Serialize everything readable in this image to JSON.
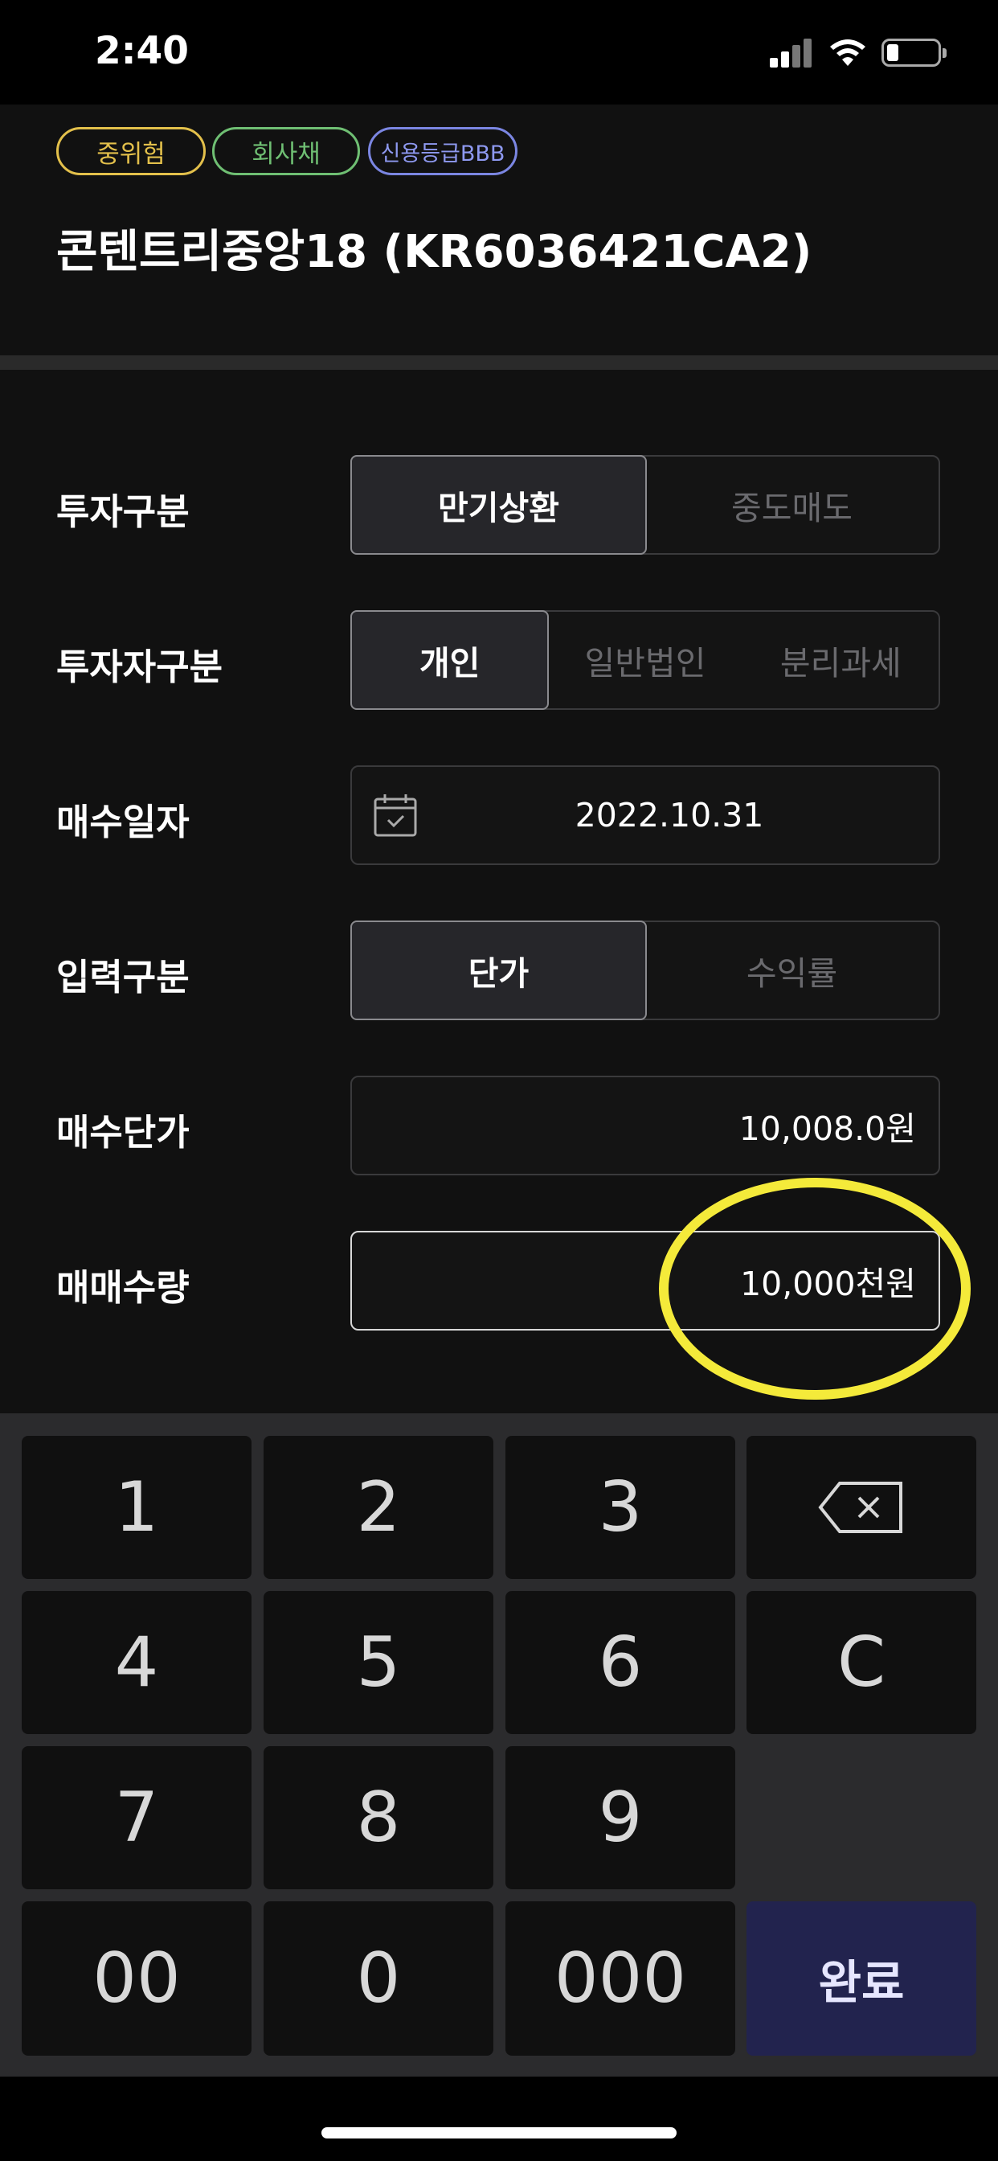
{
  "status_bar": {
    "time": "2:40",
    "icons": [
      "signal-icon",
      "wifi-icon",
      "battery-icon"
    ]
  },
  "header": {
    "badges": [
      "중위험",
      "회사채",
      "신용등급BBB"
    ],
    "badge_colors": [
      "#e3c04b",
      "#6fbf73",
      "#8e99f0"
    ],
    "title": "콘텐트리중앙18 (KR6036421CA2)"
  },
  "form": {
    "investment_type": {
      "label": "투자구분",
      "options": [
        "만기상환",
        "중도매도"
      ],
      "selected": "만기상환"
    },
    "investor_type": {
      "label": "투자자구분",
      "options": [
        "개인",
        "일반법인",
        "분리과세"
      ],
      "selected": "개인"
    },
    "purchase_date": {
      "label": "매수일자",
      "value": "2022.10.31",
      "icon": "calendar-icon"
    },
    "input_type": {
      "label": "입력구분",
      "options": [
        "단가",
        "수익률"
      ],
      "selected": "단가"
    },
    "purchase_price": {
      "label": "매수단가",
      "value": "10,008.0원"
    },
    "trade_quantity": {
      "label": "매매수량",
      "value": "10,000천원"
    }
  },
  "keypad": {
    "keys": [
      "1",
      "2",
      "3",
      "4",
      "5",
      "6",
      "C",
      "7",
      "8",
      "9",
      "00",
      "0",
      "000"
    ],
    "backspace_icon": "backspace-icon",
    "done_label": "완료",
    "done_color": "#22234e"
  },
  "annotation": {
    "highlight_color": "#f4ea3a"
  }
}
